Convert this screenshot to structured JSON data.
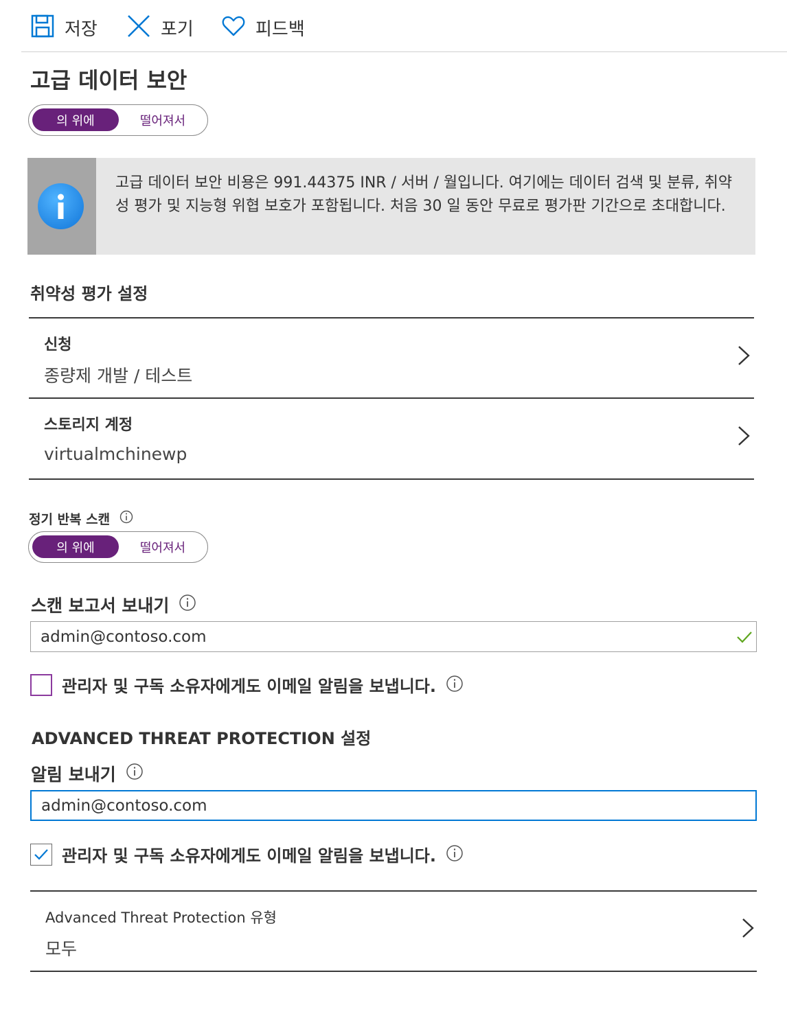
{
  "toolbar": {
    "save_label": "저장",
    "discard_label": "포기",
    "feedback_label": "피드백"
  },
  "page": {
    "title": "고급 데이터 보안",
    "toggle": {
      "on_label": "의 위에",
      "off_label": "떨어져서",
      "selected": "on"
    }
  },
  "info_banner": {
    "text": "고급 데이터 보안 비용은 991.44375 INR / 서버 / 월입니다. 여기에는 데이터 검색 및 분류, 취약성 평가 및 지능형 위협 보호가 포함됩니다. 처음 30 일 동안 무료로 평가판 기간으로 초대합니다."
  },
  "vulnerability": {
    "heading": "취약성 평가 설정",
    "subscription": {
      "title": "신청",
      "value": "종량제 개발 / 테스트"
    },
    "storage": {
      "title": "스토리지 계정",
      "value": "virtualmchinewp"
    },
    "recurring_scans": {
      "label": "정기 반복 스캔",
      "on_label": "의 위에",
      "off_label": "떨어져서",
      "selected": "on"
    },
    "send_reports": {
      "label": "스캔 보고서 보내기",
      "value": "admin@contoso.com"
    },
    "also_send": {
      "label": "관리자 및 구독 소유자에게도 이메일 알림을 보냅니다.",
      "checked": false
    }
  },
  "atp": {
    "heading": "ADVANCED THREAT PROTECTION 설정",
    "send_alerts": {
      "label": "알림 보내기",
      "value": "admin@contoso.com"
    },
    "also_send": {
      "label": "관리자 및 구독 소유자에게도 이메일 알림을 보냅니다.",
      "checked": true
    },
    "types": {
      "title": "Advanced Threat Protection 유형",
      "value": "모두"
    }
  },
  "colors": {
    "accent_purple": "#68217a",
    "link_blue": "#0078d4",
    "valid_green": "#5ea61e"
  }
}
